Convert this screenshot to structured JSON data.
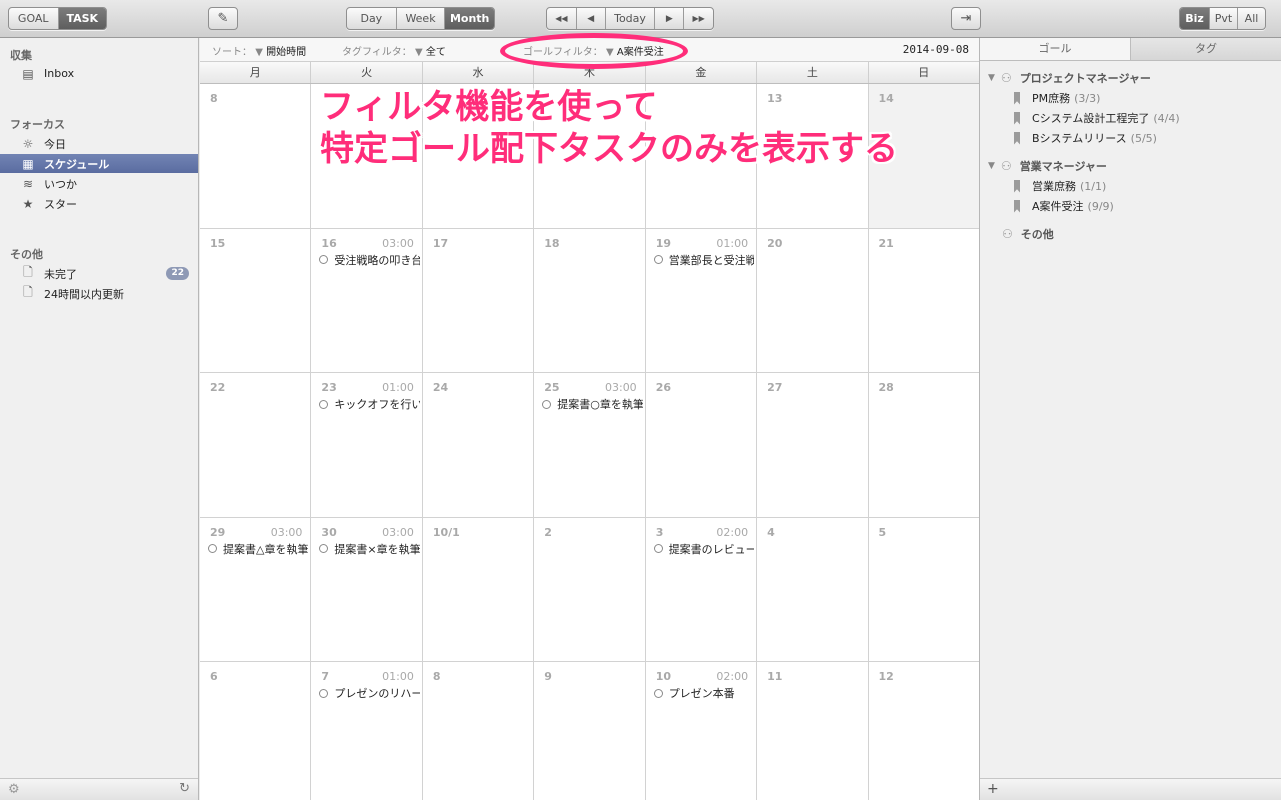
{
  "toolbar": {
    "mode_tabs": [
      "GOAL",
      "TASK"
    ],
    "active_mode": "TASK",
    "view_tabs": [
      "Day",
      "Week",
      "Month"
    ],
    "active_view": "Month",
    "nav": {
      "first": "◀◀",
      "prev": "◀",
      "today": "Today",
      "next": "▶",
      "last": "▶▶"
    },
    "scope_tabs": [
      "Biz",
      "Pvt",
      "All"
    ],
    "active_scope": "Biz",
    "icons": {
      "edit": "pencil-icon",
      "export": "sign-in-icon"
    }
  },
  "sidebar": {
    "sections": [
      {
        "header": "収集",
        "items": [
          {
            "label": "Inbox",
            "icon": "inbox-icon"
          }
        ]
      },
      {
        "header": "フォーカス",
        "items": [
          {
            "label": "今日",
            "icon": "sun-icon"
          },
          {
            "label": "スケジュール",
            "icon": "calendar-icon",
            "selected": true
          },
          {
            "label": "いつか",
            "icon": "layers-icon"
          },
          {
            "label": "スター",
            "icon": "star-icon"
          }
        ]
      },
      {
        "header": "その他",
        "items": [
          {
            "label": "未完了",
            "icon": "document-icon",
            "badge": "22"
          },
          {
            "label": "24時間以内更新",
            "icon": "document-icon"
          }
        ]
      }
    ]
  },
  "filters": {
    "sort_label": "ソート：",
    "sort_value": "開始時間",
    "tag_label": "タグフィルタ：",
    "tag_value": "全て",
    "goal_label": "ゴールフィルタ：",
    "goal_value": "A案件受注",
    "date": "2014-09-08"
  },
  "calendar": {
    "weekdays": [
      "月",
      "火",
      "水",
      "木",
      "金",
      "土",
      "日"
    ],
    "weeks": [
      [
        {
          "day": "8"
        },
        {
          "day": ""
        },
        {
          "day": ""
        },
        {
          "day": ""
        },
        {
          "day": ""
        },
        {
          "day": "13"
        },
        {
          "day": "14",
          "today": true
        }
      ],
      [
        {
          "day": "15"
        },
        {
          "day": "16",
          "time": "03:00",
          "task": "受注戦略の叩き台"
        },
        {
          "day": "17"
        },
        {
          "day": "18"
        },
        {
          "day": "19",
          "time": "01:00",
          "task": "営業部長と受注戦"
        },
        {
          "day": "20"
        },
        {
          "day": "21"
        }
      ],
      [
        {
          "day": "22"
        },
        {
          "day": "23",
          "time": "01:00",
          "task": "キックオフを行い"
        },
        {
          "day": "24"
        },
        {
          "day": "25",
          "time": "03:00",
          "task": "提案書○章を執筆"
        },
        {
          "day": "26"
        },
        {
          "day": "27"
        },
        {
          "day": "28"
        }
      ],
      [
        {
          "day": "29",
          "time": "03:00",
          "task": "提案書△章を執筆"
        },
        {
          "day": "30",
          "time": "03:00",
          "task": "提案書×章を執筆"
        },
        {
          "day": "10/1"
        },
        {
          "day": "2"
        },
        {
          "day": "3",
          "time": "02:00",
          "task": "提案書のレビュー"
        },
        {
          "day": "4"
        },
        {
          "day": "5"
        }
      ],
      [
        {
          "day": "6"
        },
        {
          "day": "7",
          "time": "01:00",
          "task": "プレゼンのリハー"
        },
        {
          "day": "8"
        },
        {
          "day": "9"
        },
        {
          "day": "10",
          "time": "02:00",
          "task": "プレゼン本番"
        },
        {
          "day": "11"
        },
        {
          "day": "12"
        }
      ]
    ]
  },
  "annotation": {
    "line1": "フィルタ機能を使って",
    "line2": "特定ゴール配下タスクのみを表示する",
    "color": "#ff2d7a"
  },
  "right_panel": {
    "tabs": [
      "ゴール",
      "タグ"
    ],
    "active_tab": "ゴール",
    "groups": [
      {
        "name": "プロジェクトマネージャー",
        "goals": [
          {
            "label": "PM庶務",
            "count": "(3/3)"
          },
          {
            "label": "Cシステム設計工程完了",
            "count": "(4/4)"
          },
          {
            "label": "Bシステムリリース",
            "count": "(5/5)"
          }
        ]
      },
      {
        "name": "営業マネージャー",
        "goals": [
          {
            "label": "営業庶務",
            "count": "(1/1)"
          },
          {
            "label": "A案件受注",
            "count": "(9/9)"
          }
        ]
      }
    ],
    "other_label": "その他",
    "add_label": "+"
  },
  "colors": {
    "selection": "#6577aa",
    "badge": "#8e99b5",
    "annotation": "#ff2d7a"
  }
}
